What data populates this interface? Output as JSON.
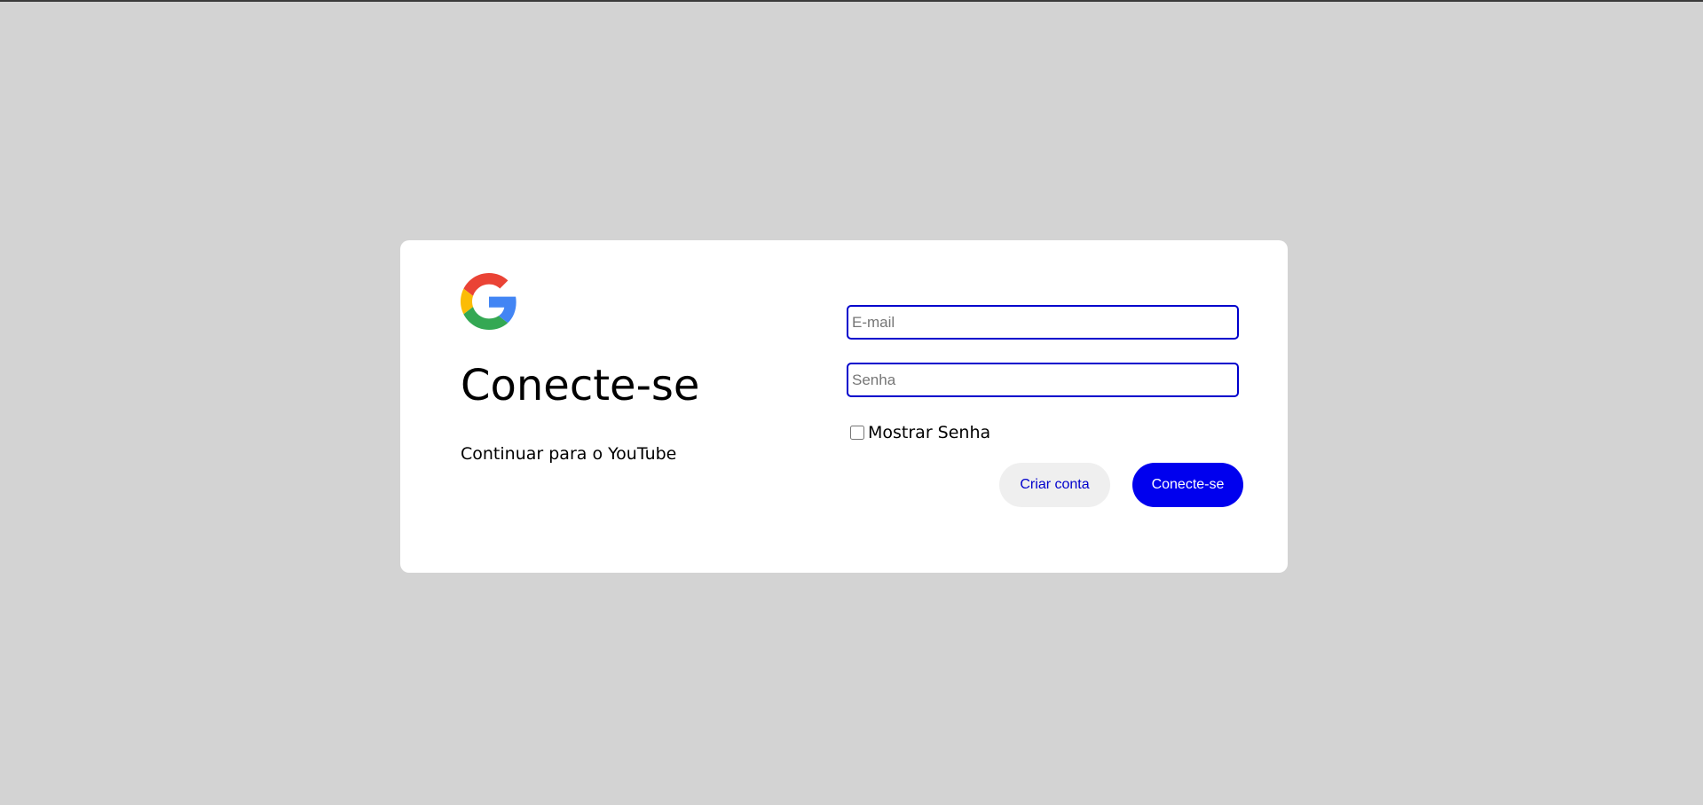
{
  "brand": {
    "logo_icon": "google-g-icon",
    "colors": {
      "red": "#EA4335",
      "yellow": "#FBBC05",
      "green": "#34A853",
      "blue": "#4285F4"
    }
  },
  "heading": {
    "title": "Conecte-se",
    "subtitle": "Continuar para o YouTube"
  },
  "form": {
    "email": {
      "value": "",
      "placeholder": "E-mail"
    },
    "password": {
      "value": "",
      "placeholder": "Senha"
    },
    "show_password": {
      "label": "Mostrar Senha",
      "checked": false
    }
  },
  "actions": {
    "create_account_label": "Criar conta",
    "sign_in_label": "Conecte-se"
  },
  "colors": {
    "page_background": "#d3d3d3",
    "card_background": "#ffffff",
    "accent": "#0000ee",
    "secondary_button": "#efefef"
  }
}
